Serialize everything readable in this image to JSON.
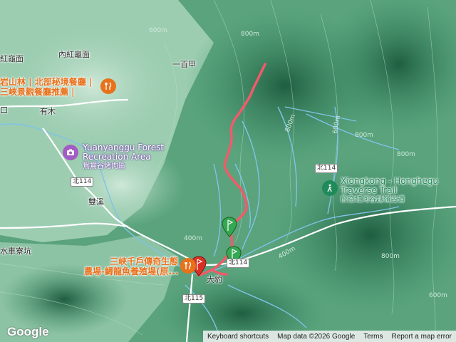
{
  "labels": {
    "place_hongguimian": "紅龜面",
    "place_nei_hongguimian": "內紅龜面",
    "place_yibaijia": "一百甲",
    "place_youmu": "有木",
    "place_shuangxi": "雙溪",
    "place_shuichetiaokeng": "水車寮坑",
    "place_dabao": "大豹",
    "place_kou": "口"
  },
  "pois": {
    "restaurant_top": {
      "line1": "岩山林 | 北部秘境餐廳 |",
      "line2": "三峽景觀餐廳推薦 |"
    },
    "forest": {
      "line1": "Yuanyanggu Forest",
      "line2": "Recreation Area",
      "sub": "鴛鴦谷烤肉區"
    },
    "trail": {
      "line1": "Xiongkong - Honghegu",
      "line2": "Traverse Trail",
      "sub": "熊空紅河谷越嶺古道"
    },
    "farm": {
      "line1": "三峽千戶傳奇生態",
      "line2": "農場-鱘龍魚養殖場(原..."
    }
  },
  "roads": {
    "bei114_a": "北114",
    "bei114_b": "北114",
    "bei114_c": "北114",
    "bei115": "北115"
  },
  "contours": [
    "600m",
    "800m",
    "800m",
    "800m",
    "600m",
    "800m",
    "400m",
    "400m",
    "800m",
    "600m"
  ],
  "icons": {
    "restaurant": "fork-knife-icon",
    "camera": "camera-icon",
    "hiking": "hiking-icon",
    "flag": "flag-icon"
  },
  "colors": {
    "track": "#f25a6a",
    "terrain_dark": "#2f7a56",
    "terrain_light": "#8fc7a8",
    "water": "#7fc3e8",
    "poi_orange": "#e8711c",
    "poi_green": "#1f8a5a",
    "marker_green": "#34a853",
    "marker_red": "#d93025"
  },
  "attribution": {
    "keyboard": "Keyboard shortcuts",
    "mapdata": "Map data ©2026 Google",
    "terms": "Terms",
    "report": "Report a map error"
  },
  "logo": "Google"
}
